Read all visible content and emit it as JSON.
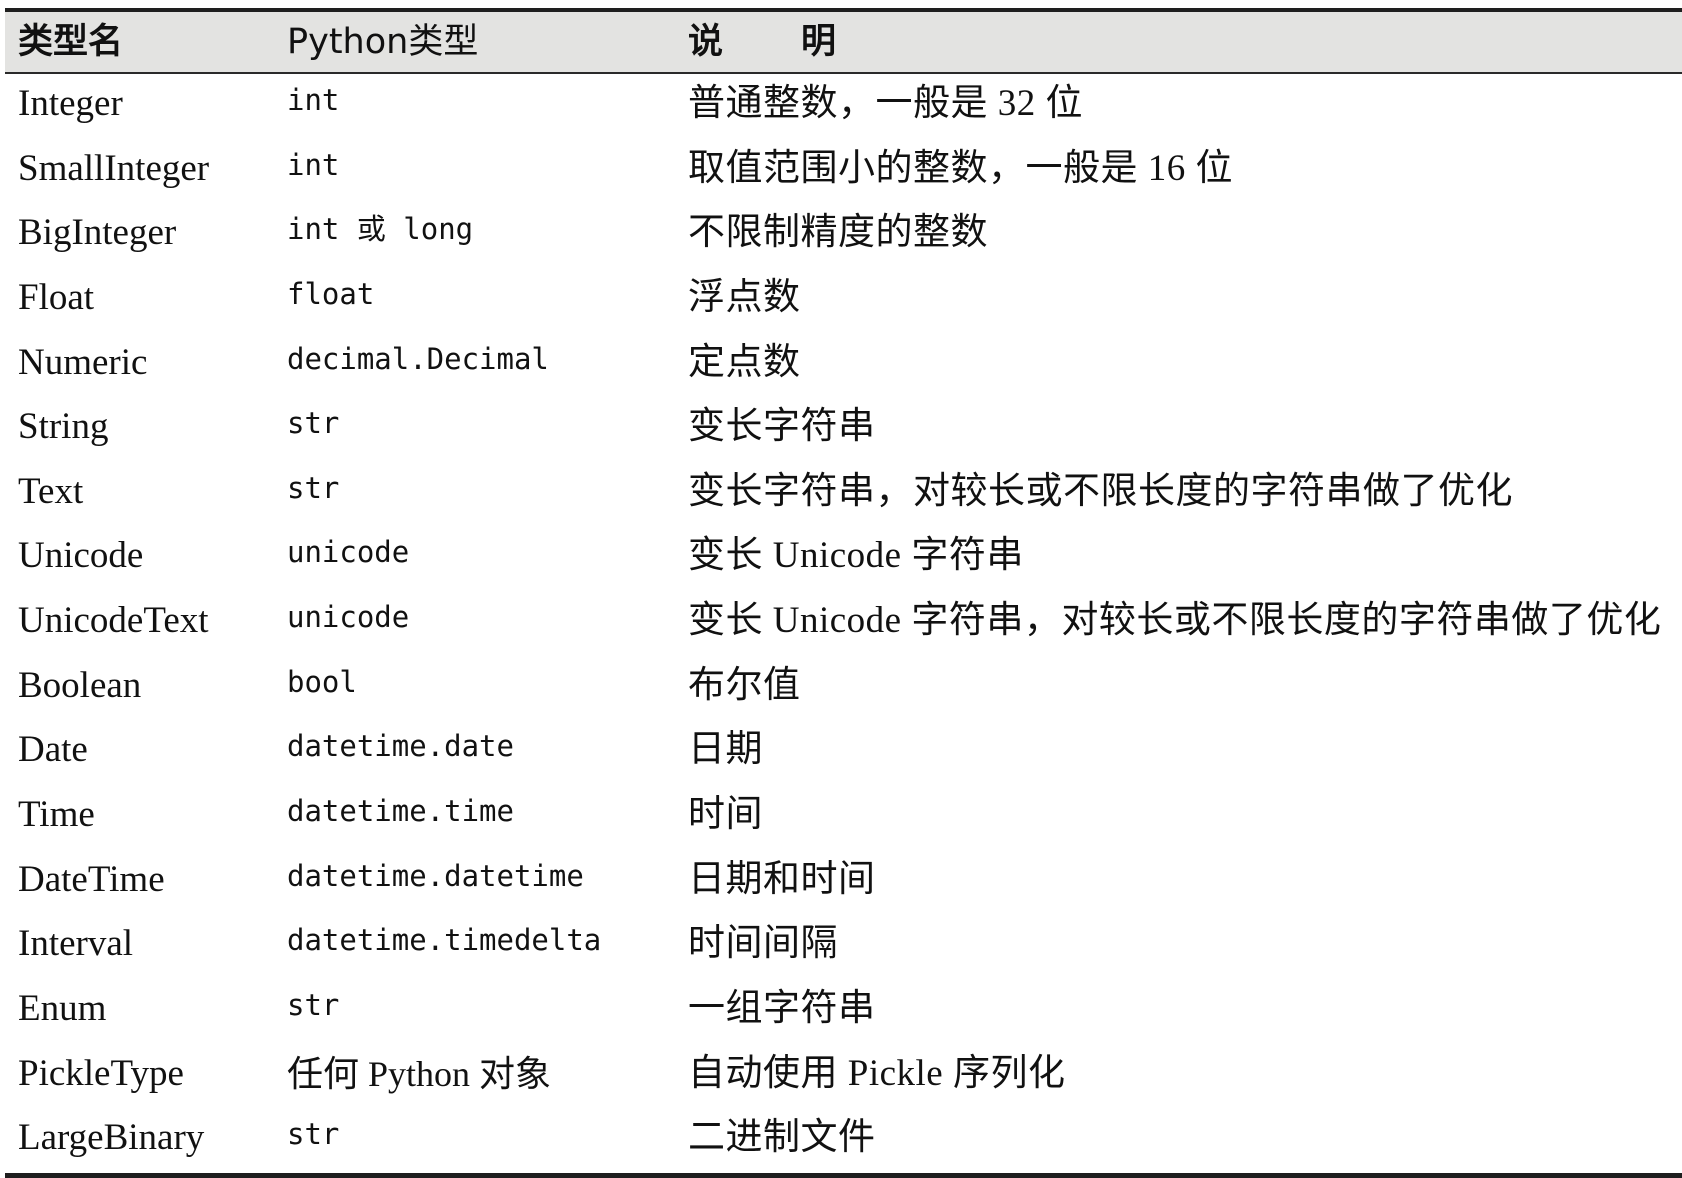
{
  "table": {
    "headers": [
      "类型名",
      "Python类型",
      "说明"
    ],
    "header_desc_parts": [
      "说",
      "明"
    ],
    "rows": [
      {
        "name": "Integer",
        "python_type": "int",
        "description": "普通整数，一般是 32 位"
      },
      {
        "name": "SmallInteger",
        "python_type": "int",
        "description": "取值范围小的整数，一般是 16 位"
      },
      {
        "name": "BigInteger",
        "python_type": "int 或 long",
        "description": "不限制精度的整数"
      },
      {
        "name": "Float",
        "python_type": "float",
        "description": "浮点数"
      },
      {
        "name": "Numeric",
        "python_type": "decimal.Decimal",
        "description": "定点数"
      },
      {
        "name": "String",
        "python_type": "str",
        "description": "变长字符串"
      },
      {
        "name": "Text",
        "python_type": "str",
        "description": "变长字符串，对较长或不限长度的字符串做了优化"
      },
      {
        "name": "Unicode",
        "python_type": "unicode",
        "description": "变长 Unicode 字符串"
      },
      {
        "name": "UnicodeText",
        "python_type": "unicode",
        "description": "变长 Unicode 字符串，对较长或不限长度的字符串做了优化"
      },
      {
        "name": "Boolean",
        "python_type": "bool",
        "description": "布尔值"
      },
      {
        "name": "Date",
        "python_type": "datetime.date",
        "description": "日期"
      },
      {
        "name": "Time",
        "python_type": "datetime.time",
        "description": "时间"
      },
      {
        "name": "DateTime",
        "python_type": "datetime.datetime",
        "description": "日期和时间"
      },
      {
        "name": "Interval",
        "python_type": "datetime.timedelta",
        "description": "时间间隔"
      },
      {
        "name": "Enum",
        "python_type": "str",
        "description": "一组字符串"
      },
      {
        "name": "PickleType",
        "python_type": "任何 Python 对象",
        "description": "自动使用 Pickle 序列化"
      },
      {
        "name": "LargeBinary",
        "python_type": "str",
        "description": "二进制文件"
      }
    ]
  },
  "colors": {
    "header_background": "#e3e3e1",
    "rule": "#1e1e1e",
    "text": "#111111"
  }
}
